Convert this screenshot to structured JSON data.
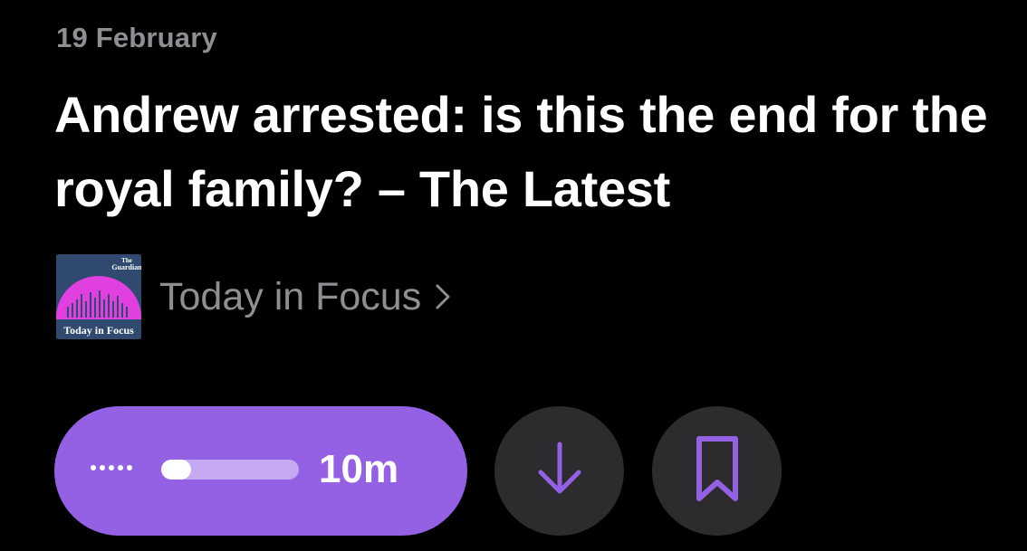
{
  "episode": {
    "date": "19 February",
    "title": "Andrew arrested: is this the end for the royal family? – The Latest"
  },
  "show": {
    "name": "Today in Focus",
    "artwork_brand": "The Guardian",
    "artwork_title": "Today in Focus",
    "chevron_icon": "chevron-right-icon"
  },
  "player": {
    "duration": "10m",
    "progress": 0.22,
    "dots_icon": "more-dots-icon",
    "download_icon": "arrow-down-icon",
    "bookmark_icon": "bookmark-icon"
  },
  "colors": {
    "accent": "#9461e5",
    "secondary_button_bg": "#2c2c2e",
    "muted_text": "#8e8e93",
    "artwork_magenta": "#e23fe0"
  }
}
